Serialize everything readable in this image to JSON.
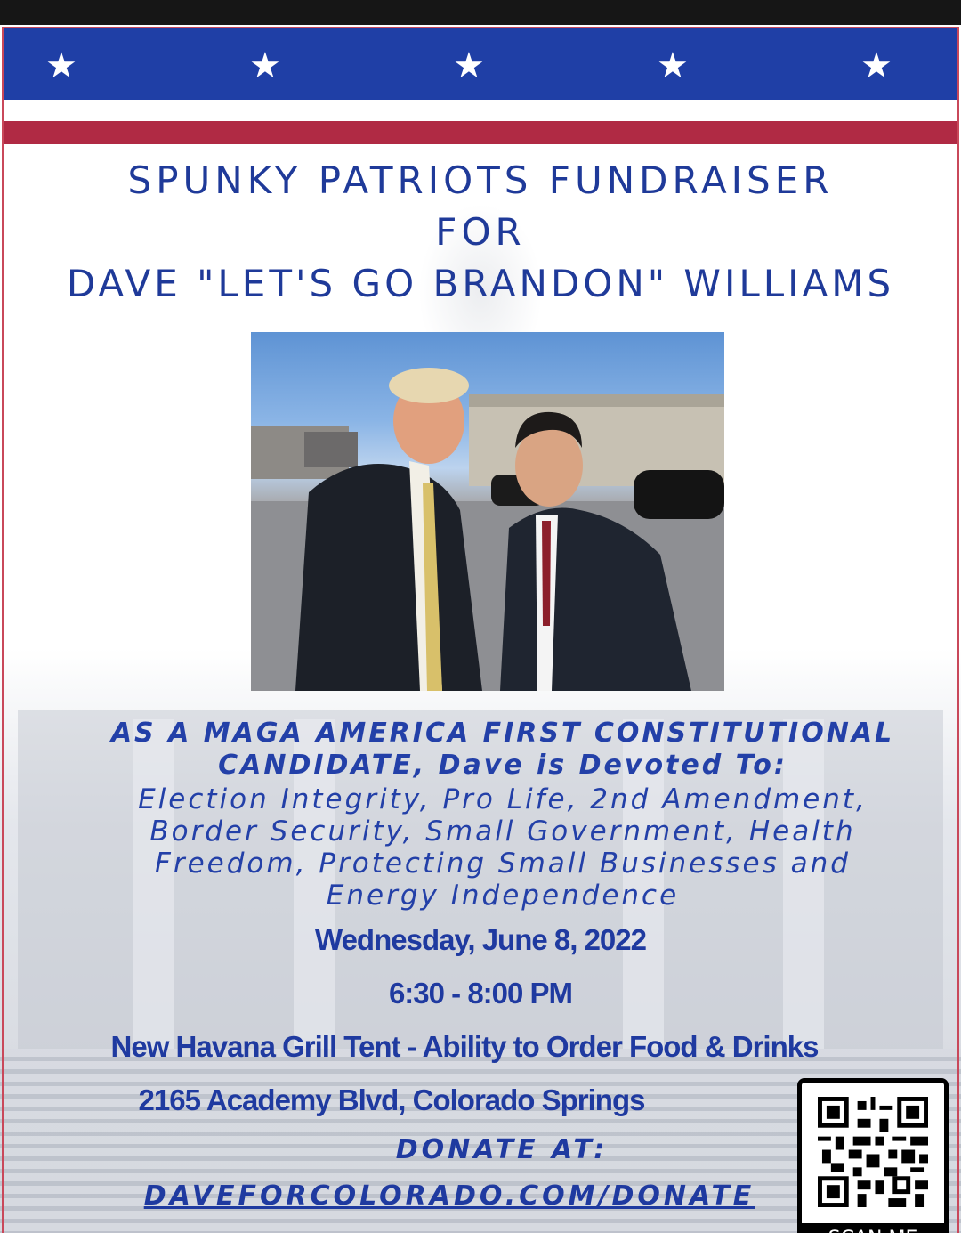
{
  "header": {
    "title_line1": "SPUNKY PATRIOTS FUNDRAISER",
    "title_line2": "FOR",
    "title_line3": "DAVE \"LET'S GO BRANDON\" WILLIAMS"
  },
  "mission": {
    "intro": "AS A MAGA AMERICA FIRST CONSTITUTIONAL CANDIDATE, Dave is Devoted To:",
    "line1": "Election Integrity, Pro Life, 2nd Amendment,",
    "line2": "Border Security, Small Government, Health",
    "line3": "Freedom, Protecting Small Businesses and",
    "line4": "Energy Independence"
  },
  "event": {
    "date": "Wednesday, June 8, 2022",
    "time": "6:30 - 8:00 PM",
    "venue": "New Havana Grill Tent - Ability to Order Food & Drinks",
    "address": "2165 Academy Blvd, Colorado Springs"
  },
  "donate": {
    "label": "DONATE AT:",
    "url": "DAVEFORCOLORADO.COM/DONATE"
  },
  "qr": {
    "label": "SCAN ME"
  },
  "colors": {
    "blue": "#1f3fa6",
    "red": "#b02a44",
    "text_blue": "#1f3aa0"
  }
}
